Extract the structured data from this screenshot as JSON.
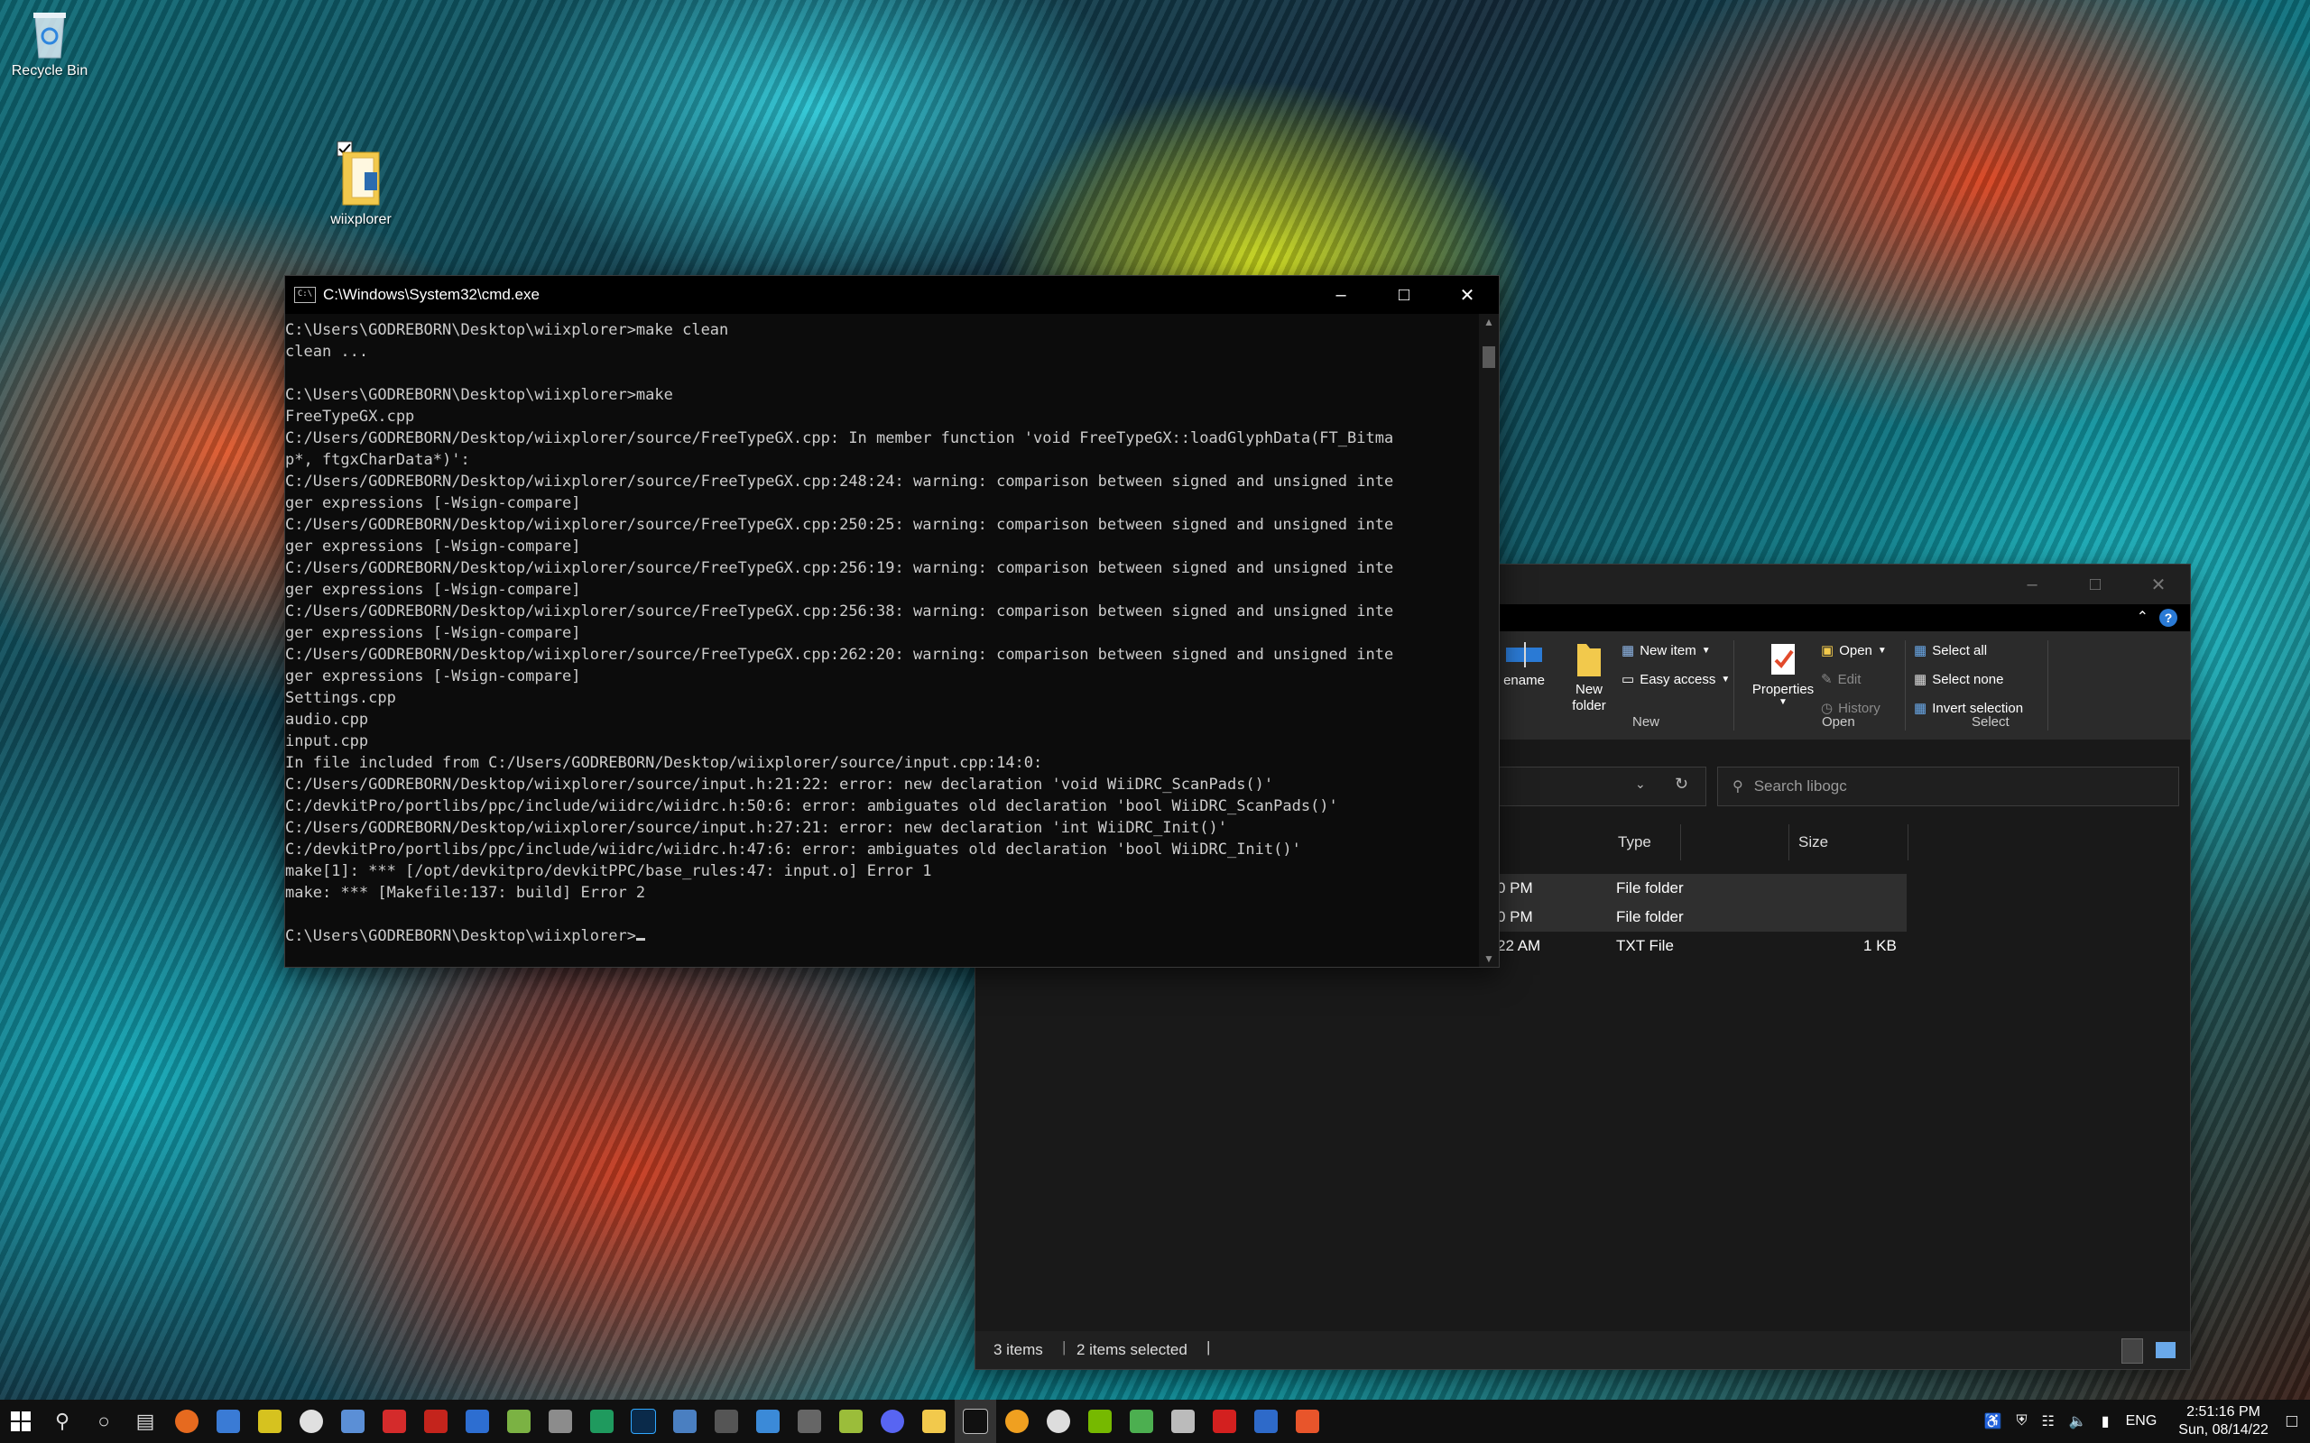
{
  "desktop": {
    "icons": [
      {
        "label": "Recycle Bin",
        "icon": "recycle-bin-icon"
      },
      {
        "label": "wiixplorer",
        "icon": "folder-icon"
      }
    ]
  },
  "cmd": {
    "title": "C:\\Windows\\System32\\cmd.exe",
    "lines": [
      "C:\\Users\\GODREBORN\\Desktop\\wiixplorer>make clean",
      "clean ...",
      "",
      "C:\\Users\\GODREBORN\\Desktop\\wiixplorer>make",
      "FreeTypeGX.cpp",
      "C:/Users/GODREBORN/Desktop/wiixplorer/source/FreeTypeGX.cpp: In member function 'void FreeTypeGX::loadGlyphData(FT_Bitma",
      "p*, ftgxCharData*)':",
      "C:/Users/GODREBORN/Desktop/wiixplorer/source/FreeTypeGX.cpp:248:24: warning: comparison between signed and unsigned inte",
      "ger expressions [-Wsign-compare]",
      "C:/Users/GODREBORN/Desktop/wiixplorer/source/FreeTypeGX.cpp:250:25: warning: comparison between signed and unsigned inte",
      "ger expressions [-Wsign-compare]",
      "C:/Users/GODREBORN/Desktop/wiixplorer/source/FreeTypeGX.cpp:256:19: warning: comparison between signed and unsigned inte",
      "ger expressions [-Wsign-compare]",
      "C:/Users/GODREBORN/Desktop/wiixplorer/source/FreeTypeGX.cpp:256:38: warning: comparison between signed and unsigned inte",
      "ger expressions [-Wsign-compare]",
      "C:/Users/GODREBORN/Desktop/wiixplorer/source/FreeTypeGX.cpp:262:20: warning: comparison between signed and unsigned inte",
      "ger expressions [-Wsign-compare]",
      "Settings.cpp",
      "audio.cpp",
      "input.cpp",
      "In file included from C:/Users/GODREBORN/Desktop/wiixplorer/source/input.cpp:14:0:",
      "C:/Users/GODREBORN/Desktop/wiixplorer/source/input.h:21:22: error: new declaration 'void WiiDRC_ScanPads()'",
      "C:/devkitPro/portlibs/ppc/include/wiidrc/wiidrc.h:50:6: error: ambiguates old declaration 'bool WiiDRC_ScanPads()'",
      "C:/Users/GODREBORN/Desktop/wiixplorer/source/input.h:27:21: error: new declaration 'int WiiDRC_Init()'",
      "C:/devkitPro/portlibs/ppc/include/wiidrc/wiidrc.h:47:6: error: ambiguates old declaration 'bool WiiDRC_Init()'",
      "make[1]: *** [/opt/devkitpro/devkitPPC/base_rules:47: input.o] Error 1",
      "make: *** [Makefile:137: build] Error 2",
      ""
    ],
    "prompt": "C:\\Users\\GODREBORN\\Desktop\\wiixplorer>"
  },
  "explorer": {
    "ribbon": {
      "rename_label": "ename",
      "new_folder_label": "New folder",
      "new_item_label": "New item",
      "easy_access_label": "Easy access",
      "new_group": "New",
      "properties_label": "Properties",
      "open_label": "Open",
      "edit_label": "Edit",
      "history_label": "History",
      "open_group": "Open",
      "select_all_label": "Select all",
      "select_none_label": "Select none",
      "invert_selection_label": "Invert selection",
      "select_group": "Select"
    },
    "search_placeholder": "Search libogc",
    "columns": {
      "type": "Type",
      "size": "Size"
    },
    "rows": [
      {
        "date": "0 PM",
        "type": "File folder",
        "size": ""
      },
      {
        "date": "0 PM",
        "type": "File folder",
        "size": ""
      },
      {
        "date": "22 AM",
        "type": "TXT File",
        "size": "1 KB"
      }
    ],
    "status": {
      "items": "3 items",
      "selected": "2 items selected"
    }
  },
  "taskbar": {
    "language": "ENG",
    "time": "2:51:16 PM",
    "date": "Sun, 08/14/22"
  },
  "colors": {
    "accent": "#2a7ad5",
    "cmd_bg": "#0c0c0c",
    "explorer_bg": "#191919"
  }
}
